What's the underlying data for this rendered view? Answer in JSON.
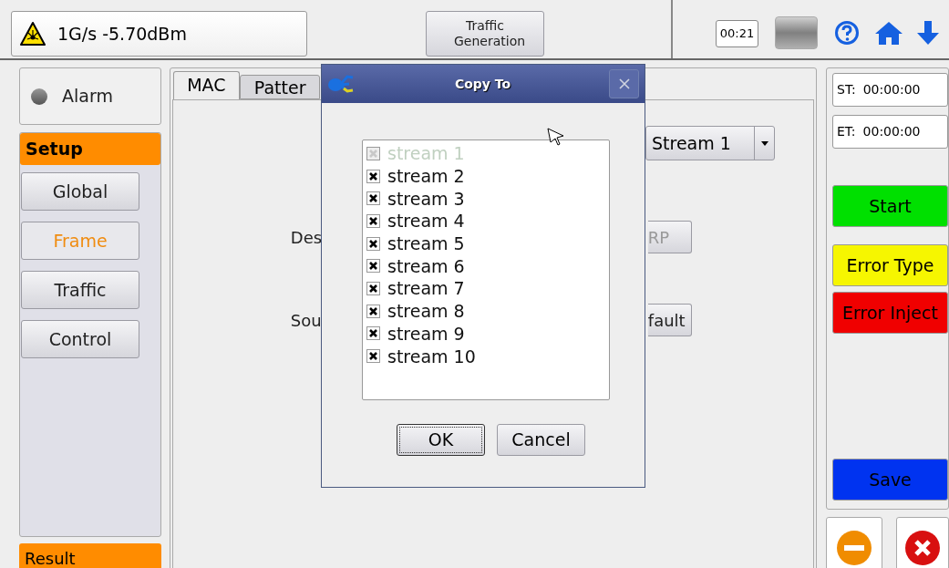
{
  "status": {
    "text": "1G/s -5.70dBm"
  },
  "mode_button": {
    "label": "Traffic Generation"
  },
  "clock": "00:21",
  "alarm": {
    "label": "Alarm",
    "on": false
  },
  "side_menu": {
    "header": "Setup",
    "items": [
      {
        "label": "Global",
        "selected": false
      },
      {
        "label": "Frame",
        "selected": true
      },
      {
        "label": "Traffic",
        "selected": false
      },
      {
        "label": "Control",
        "selected": false
      }
    ],
    "footer": "Result"
  },
  "tabs": [
    {
      "label": "MAC",
      "selected": true
    },
    {
      "label": "Patter",
      "selected": false
    }
  ],
  "stream_selector": {
    "value": "Stream 1"
  },
  "fields": [
    {
      "label": "Des",
      "button": "RP",
      "button_disabled": true
    },
    {
      "label": "Sou",
      "button": "fault",
      "button_disabled": false
    }
  ],
  "timers": [
    {
      "label": "ST:",
      "value": "00:00:00"
    },
    {
      "label": "ET:",
      "value": "00:00:00"
    }
  ],
  "actions": [
    {
      "label": "Start",
      "color": "#00e000"
    },
    {
      "label": "Error Type",
      "color": "#f6f600"
    },
    {
      "label": "Error Inject",
      "color": "#f00000"
    }
  ],
  "save": {
    "label": "Save",
    "color": "#0033f0"
  },
  "dialog": {
    "title": "Copy To",
    "items": [
      {
        "label": "stream 1",
        "checked": true,
        "disabled": true
      },
      {
        "label": "stream 2",
        "checked": true,
        "disabled": false
      },
      {
        "label": "stream 3",
        "checked": true,
        "disabled": false
      },
      {
        "label": "stream 4",
        "checked": true,
        "disabled": false
      },
      {
        "label": "stream 5",
        "checked": true,
        "disabled": false
      },
      {
        "label": "stream 6",
        "checked": true,
        "disabled": false
      },
      {
        "label": "stream 7",
        "checked": true,
        "disabled": false
      },
      {
        "label": "stream 8",
        "checked": true,
        "disabled": false
      },
      {
        "label": "stream 9",
        "checked": true,
        "disabled": false
      },
      {
        "label": "stream 10",
        "checked": true,
        "disabled": false
      }
    ],
    "buttons": [
      {
        "label": "OK",
        "focused": true
      },
      {
        "label": "Cancel",
        "focused": false
      }
    ]
  }
}
